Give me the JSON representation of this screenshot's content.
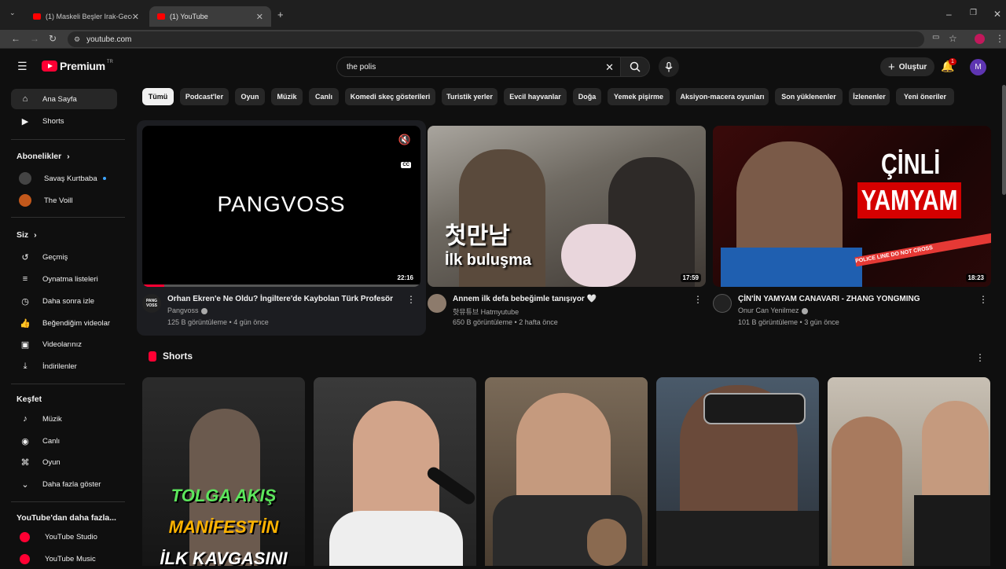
{
  "browser": {
    "tabs": [
      {
        "title": "(1) Maskeli Beşler Irak-Gece N..."
      },
      {
        "title": "(1) YouTube"
      }
    ],
    "url": "youtube.com"
  },
  "masthead": {
    "logo_text": "Premium",
    "logo_sup": "TR",
    "search_value": "the polis",
    "create_label": "Oluştur",
    "notification_count": "1",
    "avatar_letter": "M"
  },
  "sidebar": {
    "main": [
      {
        "label": "Ana Sayfa",
        "icon": "home-icon"
      },
      {
        "label": "Shorts",
        "icon": "shorts-icon"
      }
    ],
    "subscriptions_heading": "Abonelikler",
    "subscriptions": [
      {
        "label": "Savaş Kurtbaba"
      },
      {
        "label": "The Voill"
      }
    ],
    "you_heading": "Siz",
    "you": [
      {
        "label": "Geçmiş",
        "icon": "history-icon"
      },
      {
        "label": "Oynatma listeleri",
        "icon": "playlist-icon"
      },
      {
        "label": "Daha sonra izle",
        "icon": "clock-icon"
      },
      {
        "label": "Beğendiğim videolar",
        "icon": "thumbs-up-icon"
      },
      {
        "label": "Videolarınız",
        "icon": "video-icon"
      },
      {
        "label": "İndirilenler",
        "icon": "download-icon"
      }
    ],
    "explore_heading": "Keşfet",
    "explore": [
      {
        "label": "Müzik",
        "icon": "music-icon"
      },
      {
        "label": "Canlı",
        "icon": "live-icon"
      },
      {
        "label": "Oyun",
        "icon": "gaming-icon"
      },
      {
        "label": "Daha fazla göster",
        "icon": "chevron-down-icon"
      }
    ],
    "more_heading": "YouTube'dan daha fazla...",
    "more": [
      {
        "label": "YouTube Studio"
      },
      {
        "label": "YouTube Music"
      }
    ]
  },
  "chips": [
    "Tümü",
    "Podcast'ler",
    "Oyun",
    "Müzik",
    "Canlı",
    "Komedi skeç gösterileri",
    "Turistik yerler",
    "Evcil hayvanlar",
    "Doğa",
    "Yemek pişirme",
    "Aksiyon-macera oyunları",
    "Son yüklenenler",
    "İzlenenler",
    "Yeni öneriler"
  ],
  "videos": [
    {
      "thumb_text": "PANGVOSS",
      "duration": "22:16",
      "title": "Orhan Ekren'e Ne Oldu? İngiltere'de Kaybolan Türk Profesör",
      "channel": "Pangvoss",
      "meta": "125 B görüntüleme • 4 gün önce",
      "avatar_text": "PANG VOSS"
    },
    {
      "thumb_text": "첫만남",
      "thumb_sub": "İlk buluşma",
      "duration": "17:59",
      "title": "Annem ilk defa bebeğimle tanışıyor 🤍",
      "channel": "핫뮤튜브 Hatmyutube",
      "meta": "650 B görüntüleme • 2 hafta önce"
    },
    {
      "thumb_text": "ÇİNLİ",
      "thumb_sub": "YAMYAM",
      "duration": "18:23",
      "title": "ÇİN'İN YAMYAM CANAVARI - ZHANG YONGMING",
      "channel": "Onur Can Yenilmez",
      "meta": "101 B görüntüleme • 3 gün önce",
      "tape_text": "POLICE LINE DO NOT CROSS"
    }
  ],
  "shorts": {
    "heading": "Shorts",
    "items": [
      {
        "line1": "TOLGA AKIŞ",
        "line2": "MANİFEST'İN",
        "line3": "İLK KAVGASINI"
      },
      {},
      {},
      {},
      {}
    ]
  }
}
